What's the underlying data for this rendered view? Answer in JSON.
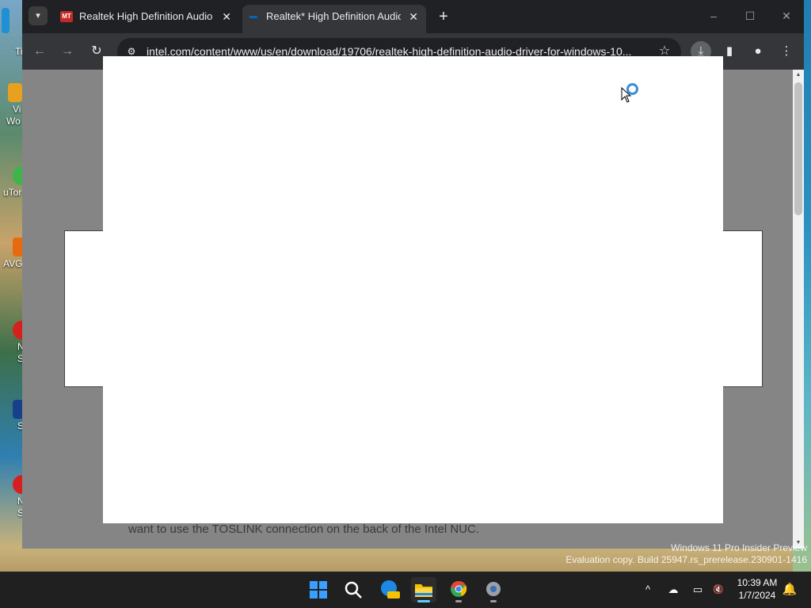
{
  "desktop": {
    "icons": [
      {
        "label": "Ti",
        "color": "#1f8fd6"
      },
      {
        "label": "Vi",
        "color": "#e8a020"
      },
      {
        "label": "Wo",
        "color": "#e8a020"
      },
      {
        "label": "uTor",
        "color": "#3db54a"
      },
      {
        "label": "AVG",
        "color": "#e86a10"
      },
      {
        "label": "N",
        "color": "#d62020"
      },
      {
        "label": "S",
        "color": "#d62020"
      },
      {
        "label": "S",
        "color": "#1a3f8a"
      },
      {
        "label": "N",
        "color": "#d62020"
      },
      {
        "label": "S",
        "color": "#d62020"
      }
    ]
  },
  "browser": {
    "tabs": [
      {
        "favicon": "MT",
        "title": "Realtek High Definition Audio D",
        "state": "inactive"
      },
      {
        "favicon": "intel",
        "title": "Realtek* High Definition Audio D",
        "state": "active"
      }
    ],
    "new_tab": "+",
    "window_controls": {
      "minimize": "–",
      "maximize": "☐",
      "close": "✕"
    },
    "nav": {
      "back": "←",
      "forward": "→",
      "reload": "↻"
    },
    "url": "intel.com/content/www/us/en/download/19706/realtek-high-definition-audio-driver-for-windows-10...",
    "icons": {
      "site_info": "⚙",
      "bookmark": "☆",
      "download": "⤓",
      "side_panel": "▮",
      "profile": "●",
      "menu": "⋮"
    }
  },
  "page": {
    "visible_text": "want to use the TOSLINK connection on the back of the Intel NUC."
  },
  "watermark": {
    "line1": "Windows 11 Pro Insider Preview",
    "line2": "Evaluation copy. Build 25947.rs_prerelease.230901-1416"
  },
  "taskbar": {
    "apps": [
      {
        "name": "start",
        "color": "#3aa0ff"
      },
      {
        "name": "search",
        "color": "#ffffff"
      },
      {
        "name": "edge-pre",
        "color": "#1e88e5"
      },
      {
        "name": "file-explorer",
        "color": "#f5c200"
      },
      {
        "name": "chrome",
        "color": "#34a853"
      },
      {
        "name": "settings",
        "color": "#9aa0a6"
      }
    ],
    "tray": {
      "chevron": "^",
      "onedrive": "☁",
      "network": "▭",
      "volume": "🔇"
    },
    "time": "10:39 AM",
    "date": "1/7/2024"
  }
}
